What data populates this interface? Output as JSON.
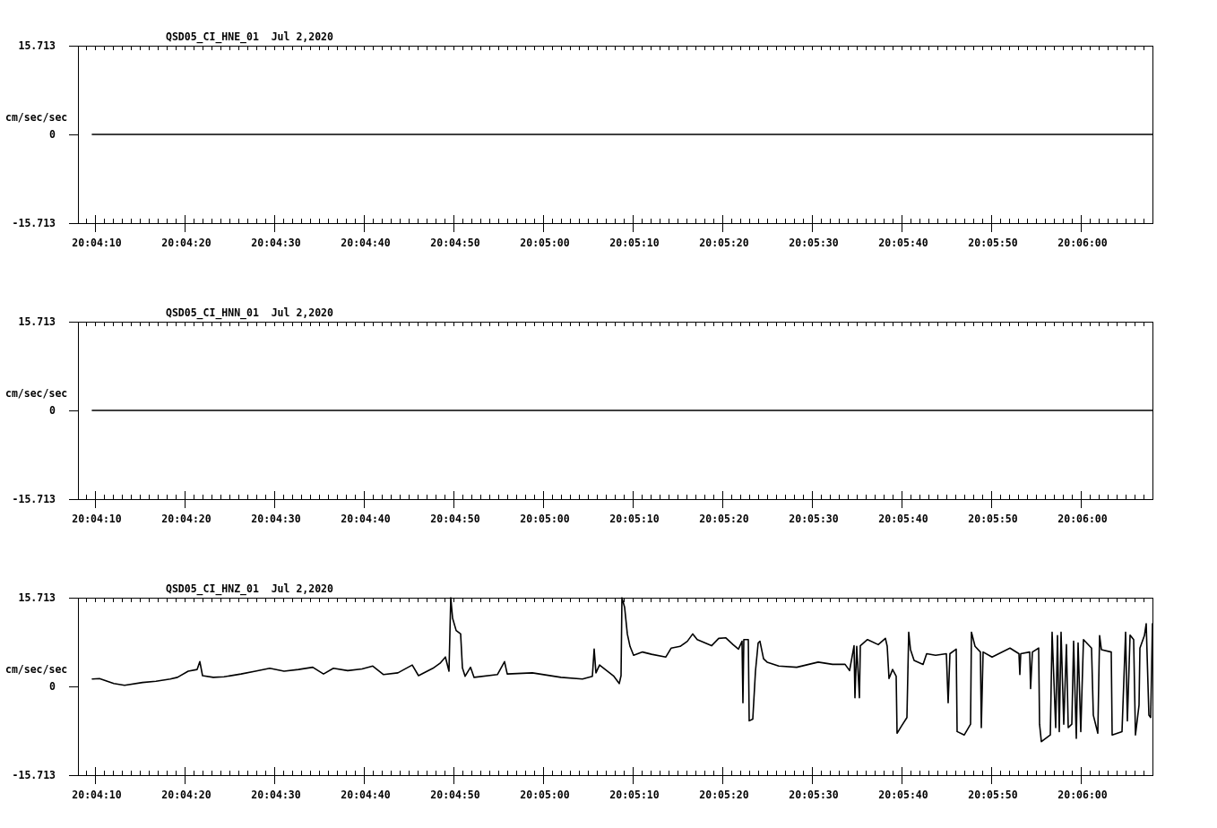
{
  "panels": [
    {
      "chart_data": {
        "type": "line",
        "title": "QSD05_CI_HNE_01  Jul 2,2020",
        "ylabel": "cm/sec/sec",
        "x": [
          72249.7,
          72368
        ],
        "series": [
          {
            "color": "#000000",
            "values": [
              0,
              0
            ]
          }
        ],
        "xlim": [
          72248.1,
          72368
        ],
        "ylim": [
          -15.713,
          15.713
        ],
        "xticks": [
          {
            "value": 72250,
            "label": "20:04:10"
          },
          {
            "value": 72260,
            "label": "20:04:20"
          },
          {
            "value": 72270,
            "label": "20:04:30"
          },
          {
            "value": 72280,
            "label": "20:04:40"
          },
          {
            "value": 72290,
            "label": "20:04:50"
          },
          {
            "value": 72300,
            "label": "20:05:00"
          },
          {
            "value": 72310,
            "label": "20:05:10"
          },
          {
            "value": 72320,
            "label": "20:05:20"
          },
          {
            "value": 72330,
            "label": "20:05:30"
          },
          {
            "value": 72340,
            "label": "20:05:40"
          },
          {
            "value": 72350,
            "label": "20:05:50"
          },
          {
            "value": 72360,
            "label": "20:06:00"
          }
        ],
        "yticks": [
          {
            "value": 15.713,
            "label": "15.713"
          },
          {
            "value": 0,
            "label": "0"
          },
          {
            "value": -15.713,
            "label": "-15.713"
          }
        ]
      }
    },
    {
      "chart_data": {
        "type": "line",
        "title": "QSD05_CI_HNN_01  Jul 2,2020",
        "ylabel": "cm/sec/sec",
        "x": [
          72249.7,
          72368
        ],
        "series": [
          {
            "color": "#000000",
            "values": [
              0,
              0
            ]
          }
        ],
        "xlim": [
          72248.1,
          72368
        ],
        "ylim": [
          -15.713,
          15.713
        ],
        "xticks": [
          {
            "value": 72250,
            "label": "20:04:10"
          },
          {
            "value": 72260,
            "label": "20:04:20"
          },
          {
            "value": 72270,
            "label": "20:04:30"
          },
          {
            "value": 72280,
            "label": "20:04:40"
          },
          {
            "value": 72290,
            "label": "20:04:50"
          },
          {
            "value": 72300,
            "label": "20:05:00"
          },
          {
            "value": 72310,
            "label": "20:05:10"
          },
          {
            "value": 72320,
            "label": "20:05:20"
          },
          {
            "value": 72330,
            "label": "20:05:30"
          },
          {
            "value": 72340,
            "label": "20:05:40"
          },
          {
            "value": 72350,
            "label": "20:05:50"
          },
          {
            "value": 72360,
            "label": "20:06:00"
          }
        ],
        "yticks": [
          {
            "value": 15.713,
            "label": "15.713"
          },
          {
            "value": 0,
            "label": "0"
          },
          {
            "value": -15.713,
            "label": "-15.713"
          }
        ]
      }
    },
    {
      "chart_data": {
        "type": "line",
        "title": "QSD05_CI_HNZ_01  Jul 2,2020",
        "ylabel": "cm/sec/sec",
        "x": [
          72249.7,
          72250.5,
          72252.1,
          72253.3,
          72255.3,
          72256.8,
          72258.4,
          72259.2,
          72260.4,
          72261.4,
          72261.7,
          72262,
          72263.2,
          72264.4,
          72266.3,
          72267.9,
          72269.5,
          72271.1,
          72272.7,
          72274.3,
          72275.5,
          72276.6,
          72278.2,
          72279.8,
          72281,
          72282.2,
          72283.8,
          72285.4,
          72286.1,
          72287.7,
          72288.5,
          72289.1,
          72289.5,
          72289.7,
          72289.9,
          72290.3,
          72290.8,
          72291,
          72291.3,
          72291.9,
          72292.3,
          72294.9,
          72295.7,
          72296,
          72298.8,
          72302,
          72304.4,
          72305.5,
          72305.7,
          72305.9,
          72306.3,
          72307.1,
          72307.9,
          72308.5,
          72308.7,
          72308.8,
          72309.1,
          72309.4,
          72309.7,
          72310.1,
          72311.1,
          72312.1,
          72313.7,
          72314.3,
          72315.3,
          72316.1,
          72316.7,
          72317.2,
          72318.8,
          72319.6,
          72320.4,
          72321.2,
          72321.8,
          72322.2,
          72322.3,
          72322.4,
          72322.9,
          72323,
          72323.4,
          72323.7,
          72324,
          72324.2,
          72324.6,
          72325,
          72326.3,
          72328.3,
          72330.7,
          72332.3,
          72333.7,
          72334.2,
          72334.7,
          72334.8,
          72335,
          72335.3,
          72335.4,
          72336.2,
          72337.4,
          72338.2,
          72338.4,
          72338.6,
          72339,
          72339.4,
          72339.5,
          72340,
          72340.6,
          72340.8,
          72341,
          72341.4,
          72342.4,
          72342.8,
          72343.8,
          72345,
          72345.2,
          72345.4,
          72346.1,
          72346.2,
          72347,
          72347.7,
          72347.8,
          72348.2,
          72348.8,
          72348.9,
          72349.1,
          72350.1,
          72352.1,
          72353.1,
          72353.2,
          72353.3,
          72354.3,
          72354.4,
          72354.6,
          72355.3,
          72355.4,
          72355.6,
          72356.6,
          72356.8,
          72357.2,
          72357.4,
          72357.6,
          72357.8,
          72358.1,
          72358.4,
          72358.6,
          72359,
          72359.2,
          72359.5,
          72359.7,
          72360,
          72360.3,
          72361.2,
          72361.4,
          72361.9,
          72362.1,
          72362.3,
          72363.4,
          72363.5,
          72364.6,
          72365,
          72365.2,
          72365.5,
          72365.9,
          72366.1,
          72366.5,
          72366.6,
          72367.1,
          72367.3,
          72367.6,
          72367.8,
          72368
        ],
        "series": [
          {
            "color": "#000000",
            "values": [
              1.3,
              1.4,
              0.5,
              0.2,
              0.7,
              0.9,
              1.3,
              1.6,
              2.7,
              3.0,
              4.4,
              1.9,
              1.6,
              1.7,
              2.2,
              2.7,
              3.2,
              2.7,
              3.0,
              3.4,
              2.2,
              3.2,
              2.8,
              3.1,
              3.6,
              2.1,
              2.4,
              3.8,
              1.9,
              3.2,
              4.1,
              5.2,
              2.7,
              15.7,
              12.1,
              9.9,
              9.3,
              3.3,
              1.8,
              3.4,
              1.6,
              2.1,
              4.4,
              2.2,
              2.4,
              1.6,
              1.3,
              1.8,
              6.6,
              2.4,
              3.8,
              2.8,
              1.8,
              0.5,
              1.9,
              15.7,
              14.0,
              9.3,
              7.1,
              5.5,
              6.1,
              5.7,
              5.2,
              6.8,
              7.1,
              8.0,
              9.3,
              8.3,
              7.2,
              8.5,
              8.6,
              7.4,
              6.6,
              8.0,
              -2.9,
              8.3,
              8.3,
              -6.1,
              -5.8,
              2.7,
              7.7,
              8.0,
              4.9,
              4.3,
              3.6,
              3.4,
              4.3,
              3.9,
              3.9,
              2.8,
              7.2,
              -2.0,
              7.1,
              -2.0,
              7.2,
              8.3,
              7.4,
              8.5,
              7.1,
              1.4,
              3.0,
              1.8,
              -8.3,
              -7.0,
              -5.5,
              9.6,
              6.5,
              4.6,
              3.9,
              5.8,
              5.5,
              5.8,
              -2.9,
              5.8,
              6.6,
              -8.0,
              -8.6,
              -6.7,
              9.6,
              7.1,
              6.1,
              -7.3,
              6.1,
              5.2,
              6.8,
              5.8,
              2.1,
              5.8,
              6.1,
              -0.4,
              6.1,
              6.8,
              -6.7,
              -9.8,
              -8.6,
              9.6,
              -7.3,
              9.0,
              -8.0,
              9.6,
              -6.7,
              7.4,
              -7.3,
              -6.7,
              8.0,
              -9.2,
              7.7,
              -8.0,
              8.3,
              6.8,
              -5.1,
              -8.3,
              9.0,
              6.5,
              6.1,
              -8.6,
              -8.0,
              9.6,
              -6.1,
              9.1,
              8.3,
              -8.6,
              -3.3,
              6.8,
              9.0,
              11.1,
              -5.1,
              -5.5,
              11.1
            ]
          }
        ],
        "xlim": [
          72248.1,
          72368
        ],
        "ylim": [
          -15.713,
          15.713
        ],
        "xticks": [
          {
            "value": 72250,
            "label": "20:04:10"
          },
          {
            "value": 72260,
            "label": "20:04:20"
          },
          {
            "value": 72270,
            "label": "20:04:30"
          },
          {
            "value": 72280,
            "label": "20:04:40"
          },
          {
            "value": 72290,
            "label": "20:04:50"
          },
          {
            "value": 72300,
            "label": "20:05:00"
          },
          {
            "value": 72310,
            "label": "20:05:10"
          },
          {
            "value": 72320,
            "label": "20:05:20"
          },
          {
            "value": 72330,
            "label": "20:05:30"
          },
          {
            "value": 72340,
            "label": "20:05:40"
          },
          {
            "value": 72350,
            "label": "20:05:50"
          },
          {
            "value": 72360,
            "label": "20:06:00"
          }
        ],
        "yticks": [
          {
            "value": 15.713,
            "label": "15.713"
          },
          {
            "value": 0,
            "label": "0"
          },
          {
            "value": -15.713,
            "label": "-15.713"
          }
        ]
      }
    }
  ]
}
